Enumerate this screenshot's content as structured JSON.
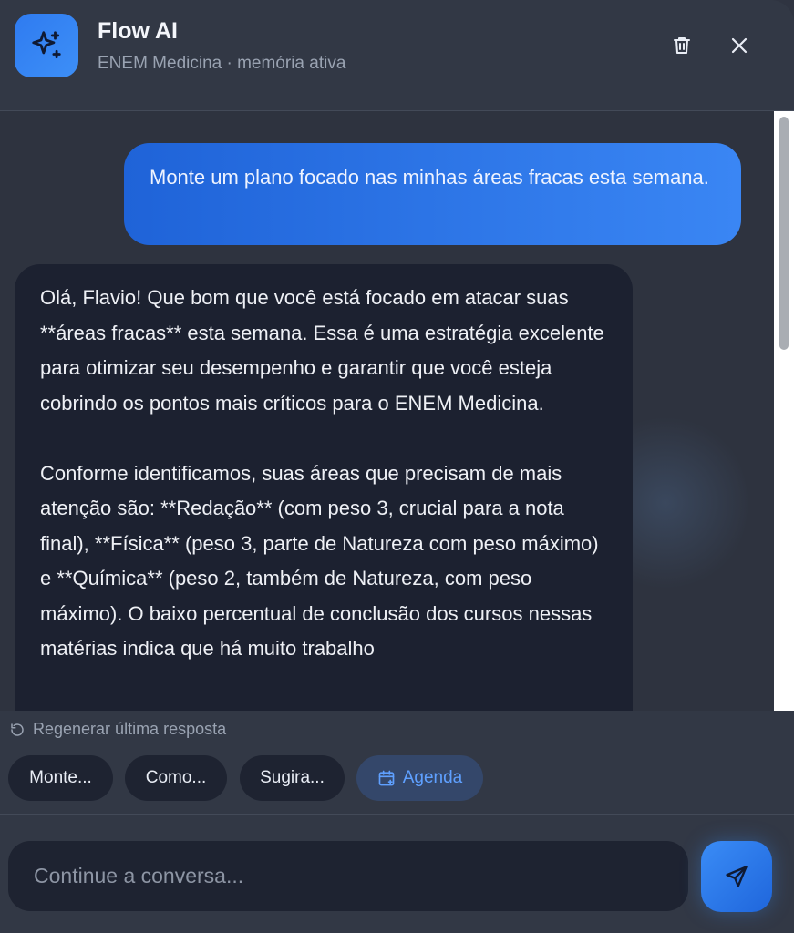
{
  "header": {
    "title": "Flow AI",
    "subtitle": "ENEM Medicina · memória ativa",
    "logo_icon": "sparkles-icon",
    "trash_icon": "trash-icon",
    "close_icon": "close-icon"
  },
  "chat": {
    "user_message": "Monte um plano focado nas minhas áreas fracas esta semana.",
    "assistant_paragraphs": [
      "Olá, Flavio! Que bom que você está focado em atacar suas **áreas fracas** esta semana. Essa é uma estratégia excelente para otimizar seu desempenho e garantir que você esteja cobrindo os pontos mais críticos para o ENEM Medicina.",
      "Conforme identificamos, suas áreas que precisam de mais atenção são: **Redação** (com peso 3, crucial para a nota final), **Física** (peso 3, parte de Natureza com peso máximo) e **Química** (peso 2, também de Natureza, com peso máximo). O baixo percentual de conclusão dos cursos nessas matérias indica que há muito trabalho"
    ]
  },
  "actions": {
    "regenerate_label": "Regenerar última resposta",
    "chips": [
      "Monte...",
      "Como...",
      "Sugira..."
    ],
    "agenda_label": "Agenda"
  },
  "composer": {
    "placeholder": "Continue a conversa..."
  },
  "colors": {
    "accent": "#2f7bf0",
    "user_bubble": "#1f63d8",
    "assistant_bubble": "#1c2130",
    "agenda_text": "#5fa0ff"
  }
}
